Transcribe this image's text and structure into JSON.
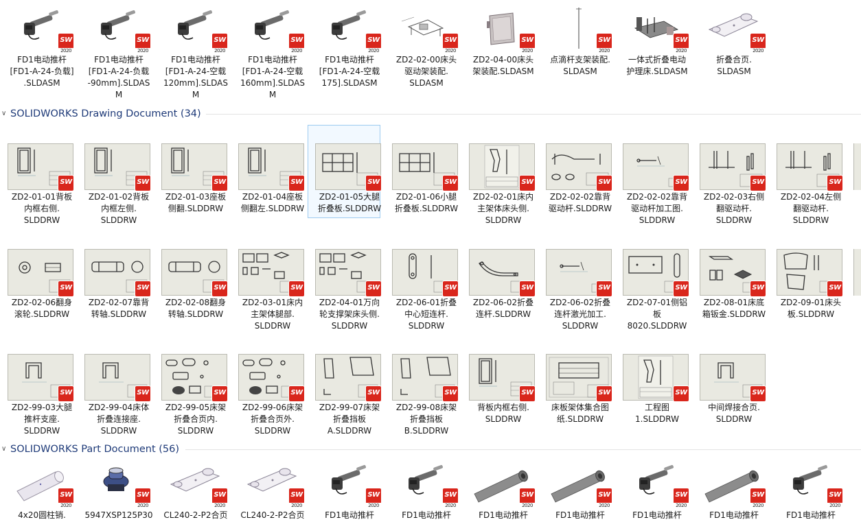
{
  "top_row": [
    {
      "label": "FD1电动推杆\n[FD1-A-24-负载]\n.SLDASM",
      "icon": "actuator-icon"
    },
    {
      "label": "FD1电动推杆\n[FD1-A-24-负载\n-90mm].SLDAS\nM",
      "icon": "actuator-icon"
    },
    {
      "label": "FD1电动推杆\n[FD1-A-24-空载\n120mm].SLDAS\nM",
      "icon": "actuator-icon"
    },
    {
      "label": "FD1电动推杆\n[FD1-A-24-空载\n160mm].SLDAS\nM",
      "icon": "actuator-icon"
    },
    {
      "label": "FD1电动推杆\n[FD1-A-24-空载\n175].SLDASM",
      "icon": "actuator-icon"
    },
    {
      "label": "ZD2-02-00床头\n驱动架装配.\nSLDASM",
      "icon": "frame-assembly-icon"
    },
    {
      "label": "ZD2-04-00床头\n架装配.SLDASM",
      "icon": "headboard-icon"
    },
    {
      "label": "点滴杆支架装配.\nSLDASM",
      "icon": "iv-pole-icon"
    },
    {
      "label": "一体式折叠电动\n护理床.SLDASM",
      "icon": "bed-icon"
    },
    {
      "label": "折叠合页.\nSLDASM",
      "icon": "hinge-icon"
    }
  ],
  "sw_badge": {
    "text": "SW",
    "year": "2020",
    "color": "#d9261c"
  },
  "drawing_group": {
    "title": "SOLIDWORKS Drawing Document (34)"
  },
  "part_group": {
    "title": "SOLIDWORKS Part Document (56)"
  },
  "drawings_row1": [
    {
      "label": "ZD2-01-01背板\n内框右侧.\nSLDDRW",
      "icon": "frame-drawing-icon"
    },
    {
      "label": "ZD2-01-02背板\n内框左侧.\nSLDDRW",
      "icon": "frame-drawing-icon"
    },
    {
      "label": "ZD2-01-03座板\n侧翻.SLDDRW",
      "icon": "frame-drawing-icon"
    },
    {
      "label": "ZD2-01-04座板\n侧翻左.SLDDRW",
      "icon": "frame-drawing-icon"
    },
    {
      "label": "ZD2-01-05大腿\n折叠板.SLDDRW",
      "icon": "panel-drawing-icon"
    },
    {
      "label": "ZD2-01-06小腿\n折叠板.SLDDRW",
      "icon": "panel-drawing-icon"
    },
    {
      "label": "ZD2-02-01床内\n主架体床头侧.\nSLDDRW",
      "icon": "portrait-drawing-icon"
    },
    {
      "label": "ZD2-02-02靠背\n驱动杆.SLDDRW",
      "icon": "arm-drawing-icon"
    },
    {
      "label": "ZD2-02-02靠背\n驱动杆加工图.\nSLDDRW",
      "icon": "sparse-drawing-icon"
    },
    {
      "label": "ZD2-02-03右侧\n翻驱动杆.\nSLDDRW",
      "icon": "lever-drawing-icon"
    },
    {
      "label": "ZD2-02-04左侧\n翻驱动杆.\nSLDDRW",
      "icon": "lever-drawing-icon"
    }
  ],
  "drawings_row2": [
    {
      "label": "ZD2-02-06翻身\n滚轮.SLDDRW",
      "icon": "roller-drawing-icon"
    },
    {
      "label": "ZD2-02-07靠背\n转轴.SLDDRW",
      "icon": "shaft-drawing-icon"
    },
    {
      "label": "ZD2-02-08翻身\n转轴.SLDDRW",
      "icon": "shaft-drawing-icon"
    },
    {
      "label": "ZD2-03-01床内\n主架体腿部.\nSLDDRW",
      "icon": "multi-drawing-icon"
    },
    {
      "label": "ZD2-04-01万向\n轮支撑架床头侧.\nSLDDRW",
      "icon": "multi-drawing-icon"
    },
    {
      "label": "ZD2-06-01折叠\n中心短连杆.\nSLDDRW",
      "icon": "link-drawing-icon"
    },
    {
      "label": "ZD2-06-02折叠\n连杆.SLDDRW",
      "icon": "bent-link-drawing-icon"
    },
    {
      "label": "ZD2-06-02折叠\n连杆激光加工.\nSLDDRW",
      "icon": "sparse-drawing-icon"
    },
    {
      "label": "ZD2-07-01侧铝\n板\n8020.SLDDRW",
      "icon": "plate-drawing-icon"
    },
    {
      "label": "ZD2-08-01床底\n箱钣金.SLDDRW",
      "icon": "box-drawing-icon"
    },
    {
      "label": "ZD2-09-01床头\n板.SLDDRW",
      "icon": "board-drawing-icon"
    }
  ],
  "drawings_row3": [
    {
      "label": "ZD2-99-03大腿\n推杆支座.\nSLDDRW",
      "icon": "bracket-drawing-icon"
    },
    {
      "label": "ZD2-99-04床体\n折叠连接座.\nSLDDRW",
      "icon": "bracket-drawing-icon"
    },
    {
      "label": "ZD2-99-05床架\n折叠合页内.\nSLDDRW",
      "icon": "hinge-drawing-icon"
    },
    {
      "label": "ZD2-99-06床架\n折叠合页外.\nSLDDRW",
      "icon": "hinge-drawing-icon"
    },
    {
      "label": "ZD2-99-07床架\n折叠挡板\nA.SLDDRW",
      "icon": "baffle-drawing-icon"
    },
    {
      "label": "ZD2-99-08床架\n折叠挡板\nB.SLDDRW",
      "icon": "baffle-drawing-icon"
    },
    {
      "label": "背板内框右侧.\nSLDDRW",
      "icon": "frame-drawing-icon"
    },
    {
      "label": "床板架体集合图\n纸.SLDDRW",
      "icon": "table-drawing-icon"
    },
    {
      "label": "工程图\n1.SLDDRW",
      "icon": "portrait-drawing-icon"
    },
    {
      "label": "中间焊接合页.\nSLDDRW",
      "icon": "bracket-drawing-icon"
    }
  ],
  "parts_row": [
    {
      "label": "4x20圆柱销.",
      "icon": "pin-icon"
    },
    {
      "label": "5947XSP125P30",
      "icon": "caster-icon"
    },
    {
      "label": "CL240-2-P2合页",
      "icon": "hinge-icon"
    },
    {
      "label": "CL240-2-P2合页",
      "icon": "hinge-icon"
    },
    {
      "label": "FD1电动推杆",
      "icon": "actuator-icon"
    },
    {
      "label": "FD1电动推杆",
      "icon": "actuator-icon"
    },
    {
      "label": "FD1电动推杆",
      "icon": "tube-icon"
    },
    {
      "label": "FD1电动推杆",
      "icon": "tube-icon"
    },
    {
      "label": "FD1电动推杆",
      "icon": "actuator-icon"
    },
    {
      "label": "FD1电动推杆",
      "icon": "tube-icon"
    },
    {
      "label": "FD1电动推杆",
      "icon": "actuator-icon"
    }
  ]
}
